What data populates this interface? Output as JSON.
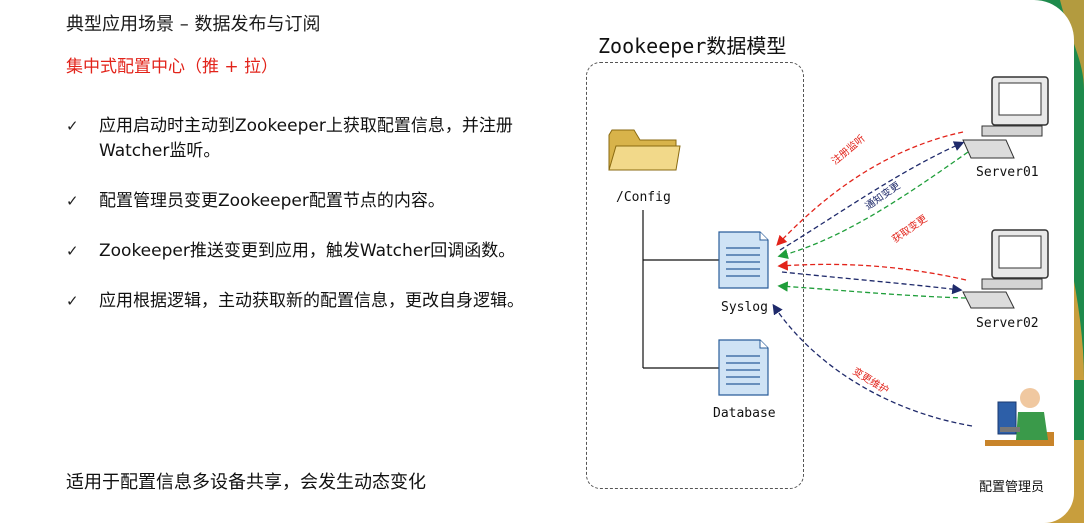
{
  "slide": {
    "title": "典型应用场景 – 数据发布与订阅",
    "subtitle": "集中式配置中心（推 + 拉）",
    "bullets": [
      "应用启动时主动到Zookeeper上获取配置信息，并注册Watcher监听。",
      "配置管理员变更Zookeeper配置节点的内容。",
      "Zookeeper推送变更到应用，触发Watcher回调函数。",
      "应用根据逻辑，主动获取新的配置信息，更改自身逻辑。"
    ],
    "footer": "适用于配置信息多设备共享，会发生动态变化"
  },
  "diagram": {
    "title": "Zookeeper数据模型",
    "nodes": {
      "config": "/Config",
      "syslog": "Syslog",
      "database": "Database"
    },
    "clients": {
      "server01": "Server01",
      "server02": "Server02",
      "admin": "配置管理员"
    },
    "arrows": {
      "register_watch": "注册监听",
      "notify_change": "通知变更",
      "fetch_change": "获取变更",
      "change_maintain": "变更维护"
    },
    "colors": {
      "red": "#e2231a",
      "navy": "#1f2a6b",
      "green": "#1f9e3a",
      "accent_green": "#1e8f4a",
      "accent_orange": "#f2a23a"
    }
  }
}
